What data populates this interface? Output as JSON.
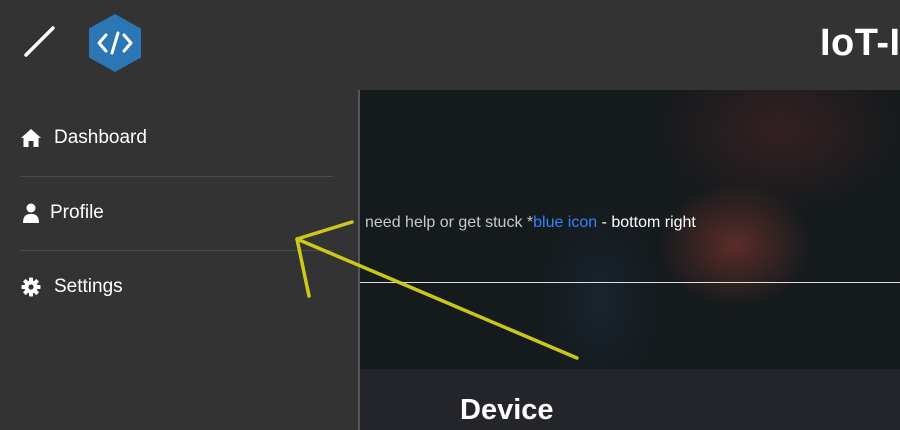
{
  "header": {
    "app_title": "IoT-I",
    "menu_icon": "slash-toggle-icon",
    "logo_icon": "code-hexagon-logo",
    "logo_color": "#2b77b5"
  },
  "sidebar": {
    "items": [
      {
        "label": "Dashboard",
        "icon": "home-icon"
      },
      {
        "label": "Profile",
        "icon": "user-icon"
      },
      {
        "label": "Settings",
        "icon": "gear-icon"
      }
    ]
  },
  "main": {
    "help": {
      "prefix": "need help or get stuck *",
      "highlight": "blue icon",
      "suffix": " - bottom right",
      "highlight_color": "#2f86ff"
    },
    "section_title": "Device"
  },
  "annotation": {
    "type": "hand-drawn arrow pointing left",
    "color": "#d8d61a"
  }
}
